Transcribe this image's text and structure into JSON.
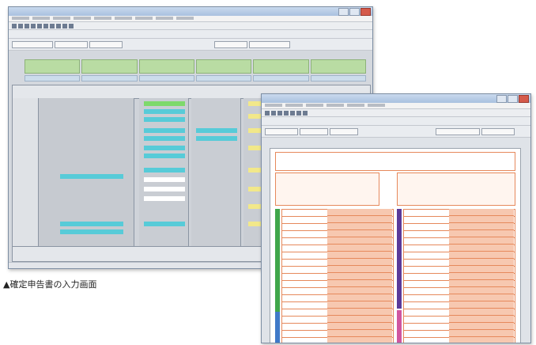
{
  "caption": "▲確定申告書の入力画面",
  "colors": {
    "title_bar": "#a9c1df",
    "tab_green": "#b9dca3",
    "cell_cyan": "#57cbd8",
    "cell_yellow": "#f2e88a",
    "form_orange": "#e6895c",
    "form_green_bar": "#3fa64a",
    "form_purple_bar": "#5b3a9a",
    "form_blue_bar": "#3f79c8"
  },
  "icons": [
    "minimize-icon",
    "maximize-icon",
    "close-icon",
    "toolbar-icon"
  ]
}
